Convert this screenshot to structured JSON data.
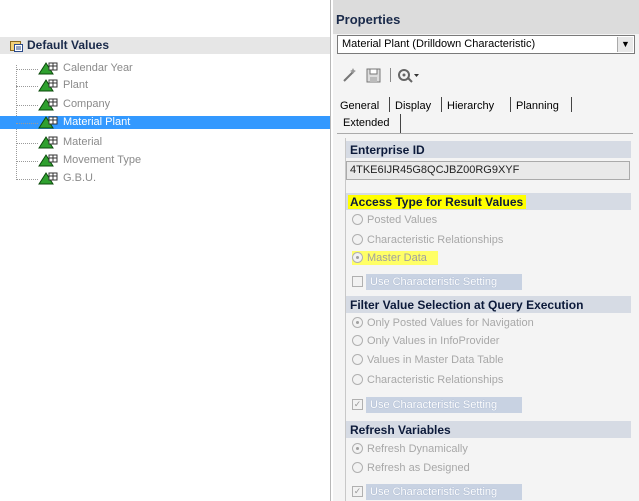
{
  "left_panel": {
    "title": "Default Values",
    "items": [
      {
        "label": "Calendar Year"
      },
      {
        "label": "Plant"
      },
      {
        "label": "Company"
      },
      {
        "label": "Material Plant",
        "selected": true
      },
      {
        "label": "Material"
      },
      {
        "label": "Movement Type"
      },
      {
        "label": "G.B.U."
      }
    ]
  },
  "properties": {
    "title": "Properties",
    "selected_object": "Material Plant (Drilldown Characteristic)",
    "toolbar_icons": [
      "wand-icon",
      "save-icon",
      "settings-dropdown-icon"
    ],
    "tabs": [
      "General",
      "Display",
      "Hierarchy",
      "Planning",
      "Extended"
    ],
    "active_tab": "Extended",
    "enterprise_id": {
      "title": "Enterprise ID",
      "value": "4TKE6IJR45G8QCJBZ00RG9XYF"
    },
    "access_type": {
      "title": "Access Type for Result Values",
      "options": [
        "Posted Values",
        "Characteristic Relationships",
        "Master Data"
      ],
      "selected": "Master Data",
      "checkbox_label": "Use Characteristic Setting"
    },
    "filter_selection": {
      "title": "Filter Value Selection at Query Execution",
      "options": [
        "Only Posted Values for Navigation",
        "Only Values in InfoProvider",
        "Values in Master Data Table",
        "Characteristic Relationships"
      ],
      "selected": "Only Posted Values for Navigation",
      "checkbox_label": "Use Characteristic Setting"
    },
    "refresh_variables": {
      "title": "Refresh Variables",
      "options": [
        "Refresh Dynamically",
        "Refresh as Designed"
      ],
      "selected": "Refresh Dynamically",
      "checkbox_label": "Use Characteristic Setting"
    }
  },
  "colors": {
    "selection": "#3399ff",
    "highlight": "#ffff00",
    "section_header": "#d6dbe4"
  }
}
